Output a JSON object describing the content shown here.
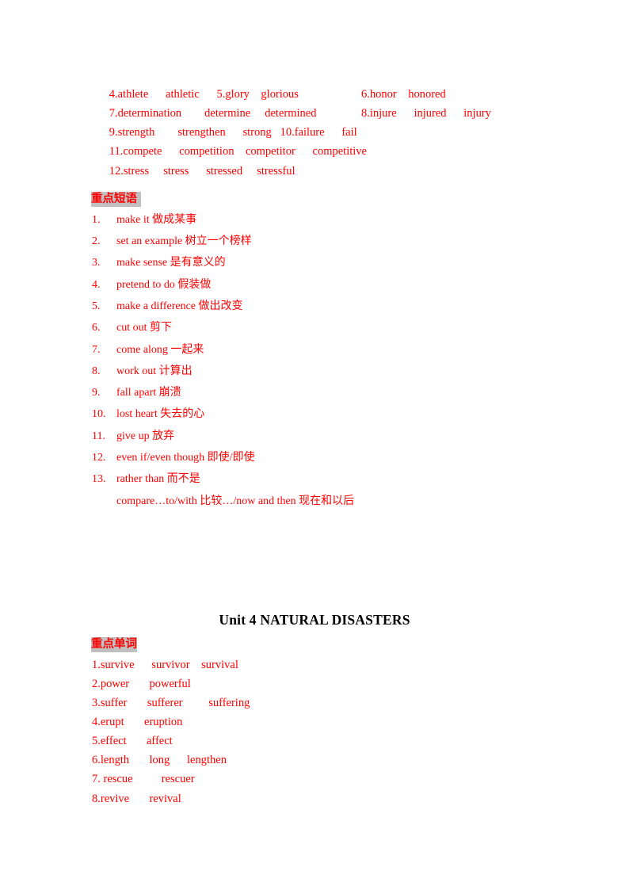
{
  "document": {
    "page_background": "#ffffff",
    "accent_color": "#FF0000",
    "highlight_color": "#C0C0C0",
    "title_color": "#000000"
  },
  "unit3_words": {
    "lines": [
      {
        "left": "4.athlete      athletic      5.glory    glorious",
        "right": "6.honor    honored"
      },
      {
        "left": "7.determination        determine     determined",
        "right": "8.injure      injured      injury"
      },
      {
        "left": "9.strength        strengthen      strong   10.failure      fail",
        "right": ""
      },
      {
        "left": "11.compete      competition    competitor      competitive",
        "right": ""
      },
      {
        "left": "12.stress     stress      stressed     stressful",
        "right": ""
      }
    ]
  },
  "phrases_section": {
    "header": "重点短语 ",
    "items": [
      {
        "num": "1.",
        "text": "make it 做成某事"
      },
      {
        "num": "2.",
        "text": "set an example 树立一个榜样"
      },
      {
        "num": "3.",
        "text": "make sense 是有意义的"
      },
      {
        "num": "4.",
        "text": "pretend to do 假装做"
      },
      {
        "num": "5.",
        "text": "make a difference 做出改变"
      },
      {
        "num": "6.",
        "text": "cut out 剪下"
      },
      {
        "num": "7.",
        "text": "come along 一起来"
      },
      {
        "num": "8.",
        "text": "work out 计算出"
      },
      {
        "num": "9.",
        "text": "fall apart 崩溃"
      },
      {
        "num": "10.",
        "text": "lost heart 失去的心"
      },
      {
        "num": "11.",
        "text": "give up 放弃"
      },
      {
        "num": "12.",
        "text": "even if/even though 即使/即使"
      },
      {
        "num": "13.",
        "text": "rather than 而不是"
      }
    ],
    "extra_line": "compare…to/with 比较…/now and then 现在和以后"
  },
  "unit4": {
    "title": "Unit 4 NATURAL DISASTERS",
    "words_header": "重点单词",
    "word_lines": [
      "1.survive      survivor    survival",
      "2.power       powerful",
      "3.suffer       sufferer         suffering",
      "4.erupt       eruption",
      "5.effect       affect",
      "6.length       long      lengthen",
      "7. rescue          rescuer",
      "8.revive       revival"
    ]
  }
}
